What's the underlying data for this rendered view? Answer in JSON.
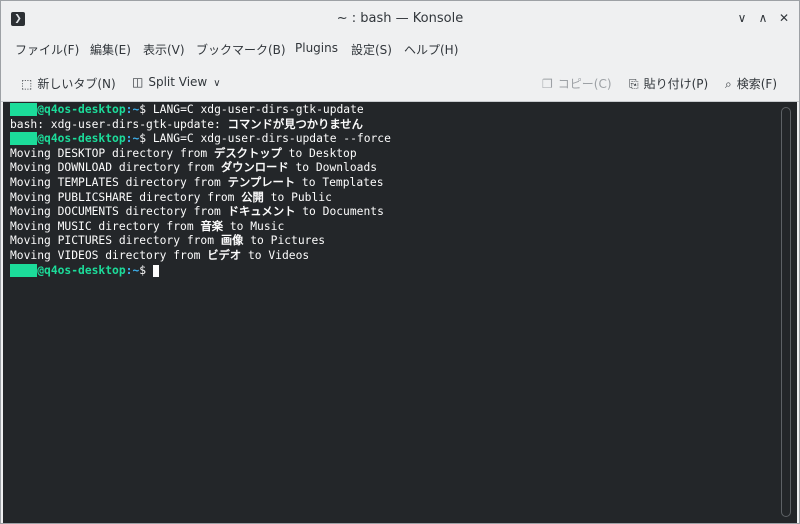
{
  "window": {
    "title": "~ : bash — Konsole"
  },
  "menubar": {
    "items": [
      "ファイル(F)",
      "編集(E)",
      "表示(V)",
      "ブックマーク(B)",
      "Plugins",
      "設定(S)",
      "ヘルプ(H)"
    ]
  },
  "toolbar": {
    "new_tab": "新しいタブ(N)",
    "split_view": "Split View",
    "copy": "コピー(C)",
    "paste": "貼り付け(P)",
    "find": "検索(F)"
  },
  "terminal": {
    "user_redacted": "xxxx",
    "host": "@q4os-desktop",
    "path": ":~",
    "prompt_symbol": "$",
    "cmd1": " LANG=C xdg-user-dirs-gtk-update",
    "err_prefix": "bash: xdg-user-dirs-gtk-update: ",
    "err_jp": "コマンドが見つかりません",
    "cmd2": " LANG=C xdg-user-dirs-update --force",
    "moves": [
      {
        "pre": "Moving DESKTOP directory from ",
        "jp": "デスクトップ",
        "post": " to Desktop"
      },
      {
        "pre": "Moving DOWNLOAD directory from ",
        "jp": "ダウンロード",
        "post": " to Downloads"
      },
      {
        "pre": "Moving TEMPLATES directory from ",
        "jp": "テンプレート",
        "post": " to Templates"
      },
      {
        "pre": "Moving PUBLICSHARE directory from ",
        "jp": "公開",
        "post": " to Public"
      },
      {
        "pre": "Moving DOCUMENTS directory from ",
        "jp": "ドキュメント",
        "post": " to Documents"
      },
      {
        "pre": "Moving MUSIC directory from ",
        "jp": "音楽",
        "post": " to Music"
      },
      {
        "pre": "Moving PICTURES directory from ",
        "jp": "画像",
        "post": " to Pictures"
      },
      {
        "pre": "Moving VIDEOS directory from ",
        "jp": "ビデオ",
        "post": " to Videos"
      }
    ]
  },
  "colors": {
    "prompt_green": "#1cdc9a",
    "path_blue": "#3daee9",
    "terminal_bg": "#232629"
  }
}
